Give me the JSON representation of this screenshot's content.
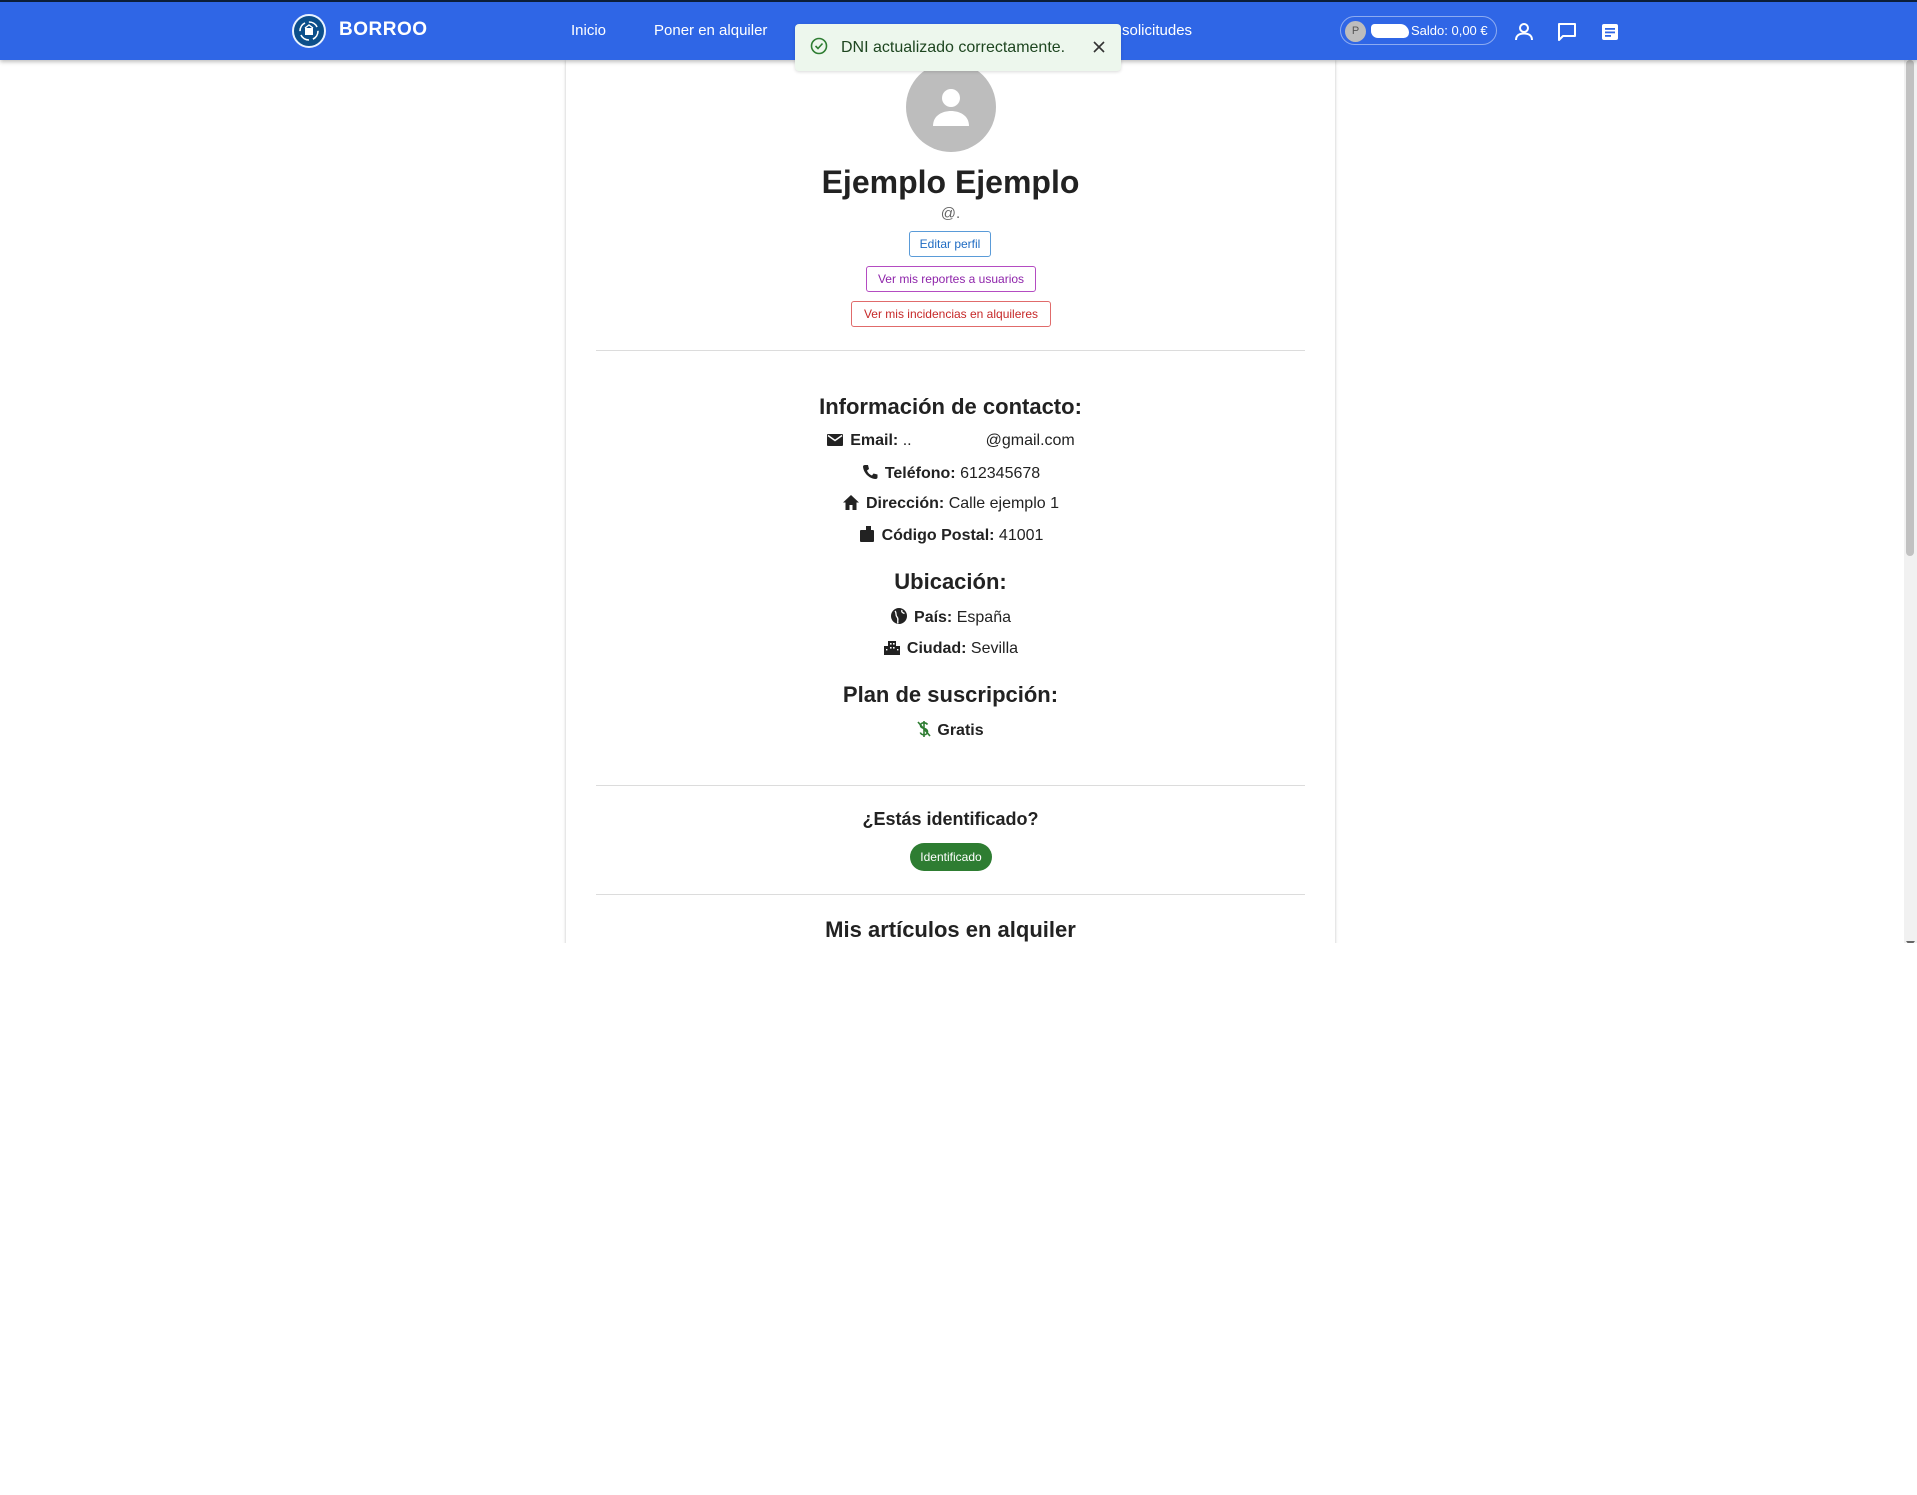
{
  "navbar": {
    "brand": "BORROO",
    "links": [
      "Inicio",
      "Poner en alquiler",
      "solicitudes"
    ],
    "balance_avatar_letter": "P",
    "balance": "Saldo: 0,00 €",
    "icons": [
      "user-icon",
      "chat-icon",
      "list-icon"
    ]
  },
  "toast": {
    "message": "DNI actualizado correctamente.",
    "type": "success"
  },
  "profile": {
    "name": "Ejemplo Ejemplo",
    "handle": "@.",
    "buttons": {
      "edit": "Editar perfil",
      "reports": "Ver mis reportes a usuarios",
      "incidents": "Ver mis incidencias en alquileres"
    }
  },
  "contact": {
    "title": "Información de contacto:",
    "email_label": "Email:",
    "email_prefix": "..",
    "email_suffix": "@gmail.com",
    "phone_label": "Teléfono:",
    "phone": "612345678",
    "address_label": "Dirección:",
    "address": "Calle ejemplo 1",
    "postal_label": "Código Postal:",
    "postal": "41001"
  },
  "location": {
    "title": "Ubicación:",
    "country_label": "País:",
    "country": "España",
    "city_label": "Ciudad:",
    "city": "Sevilla"
  },
  "subscription": {
    "title": "Plan de suscripción:",
    "plan": "Gratis"
  },
  "identification": {
    "title": "¿Estás identificado?",
    "badge": "Identificado"
  },
  "articles": {
    "title": "Mis artículos en alquiler"
  },
  "colors": {
    "navbar": "#2f66e6",
    "success_bg": "#edf7ed",
    "badge": "#2e7d32"
  }
}
